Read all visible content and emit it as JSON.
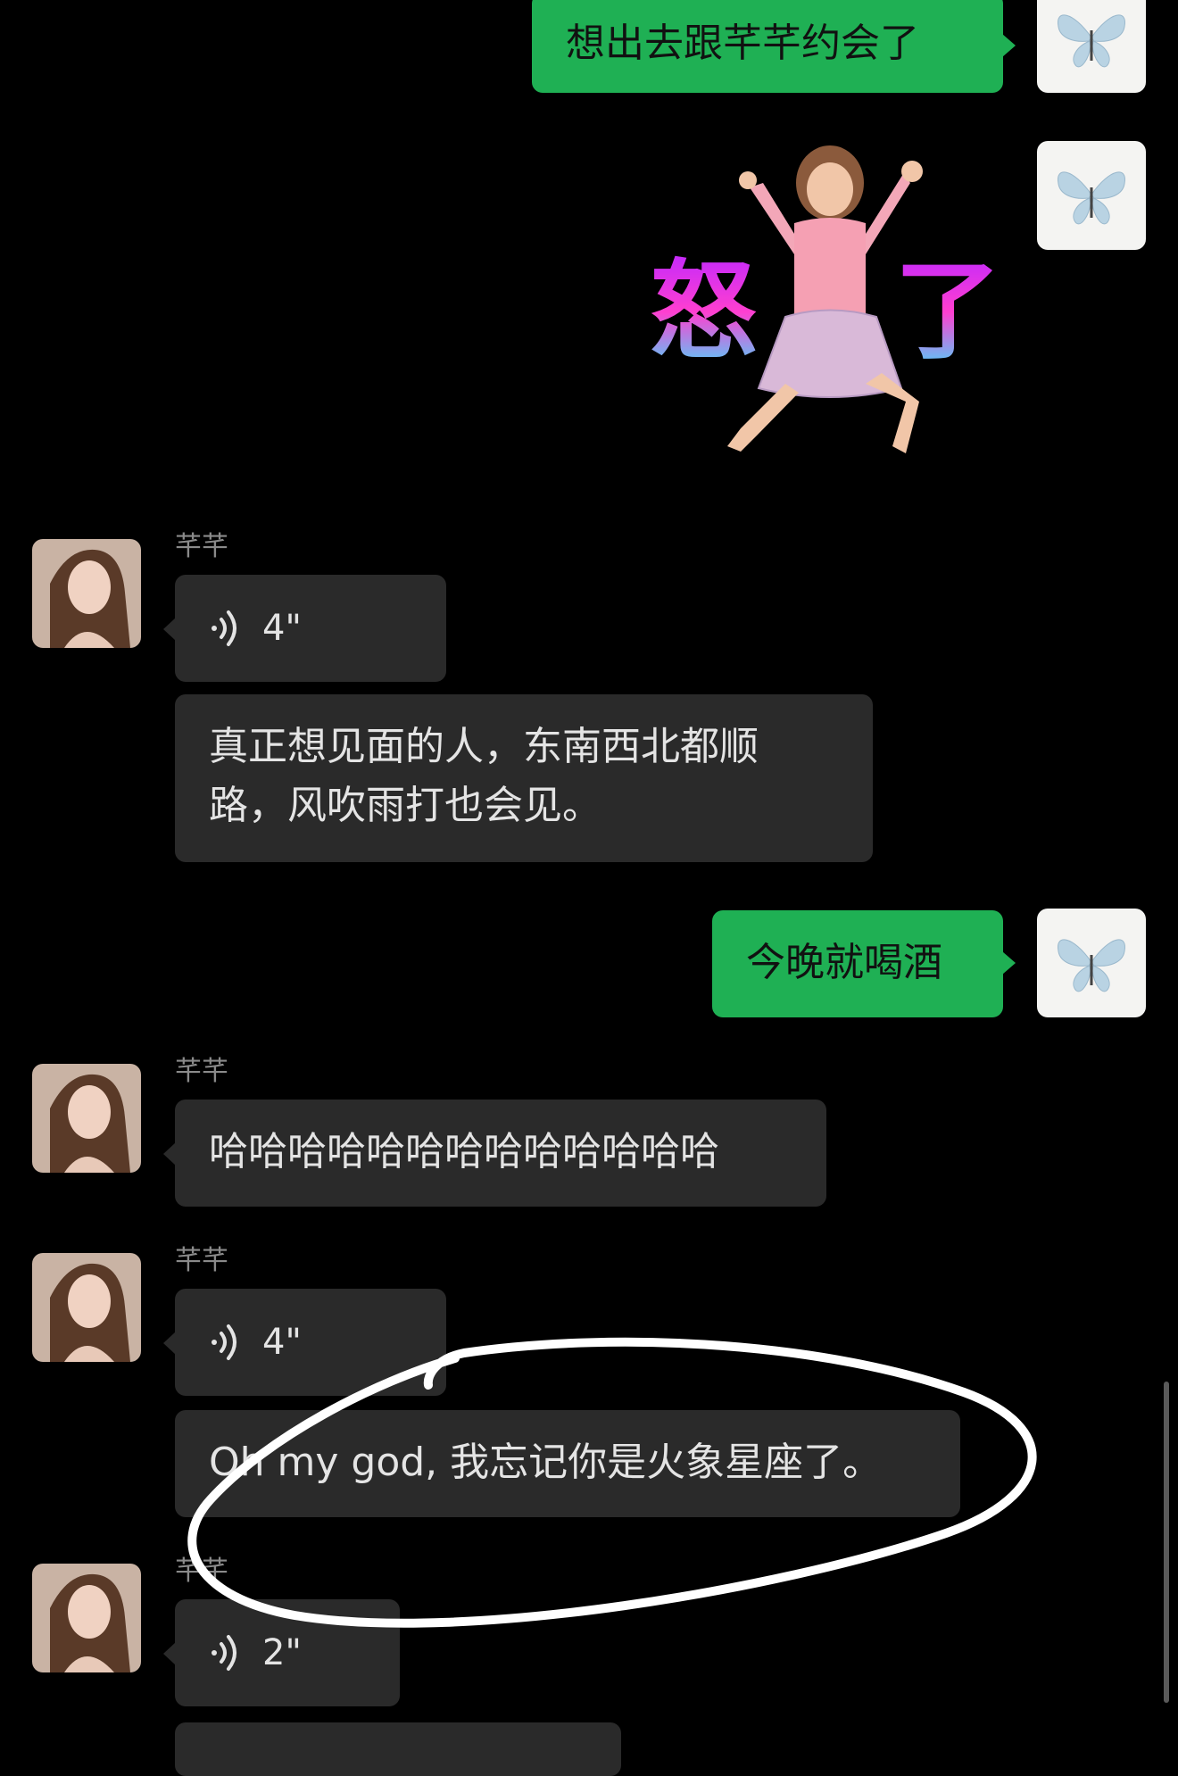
{
  "contact_name": "芊芊",
  "messages": {
    "m1": {
      "text": "想出去跟芊芊约会了"
    },
    "m2": {
      "sticker_text": "怒了"
    },
    "m3": {
      "sender": "芊芊",
      "duration": "4\""
    },
    "m4": {
      "text_line1": "真正想见面的人，东南西北都顺",
      "text_line2": "路，风吹雨打也会见。"
    },
    "m5": {
      "text": "今晚就喝酒"
    },
    "m6": {
      "sender": "芊芊",
      "text": "哈哈哈哈哈哈哈哈哈哈哈哈哈"
    },
    "m7": {
      "sender": "芊芊",
      "duration": "4\""
    },
    "m8": {
      "text": "Oh my god, 我忘记你是火象星座了。"
    },
    "m9": {
      "sender": "芊芊",
      "duration": "2\""
    }
  },
  "colors": {
    "self_bubble": "#1fb054",
    "friend_bubble": "#2a2a2a",
    "background": "#000000",
    "annotation": "#ffffff"
  },
  "icons": {
    "self_avatar": "butterfly-icon",
    "voice": "voice-wave-icon"
  }
}
